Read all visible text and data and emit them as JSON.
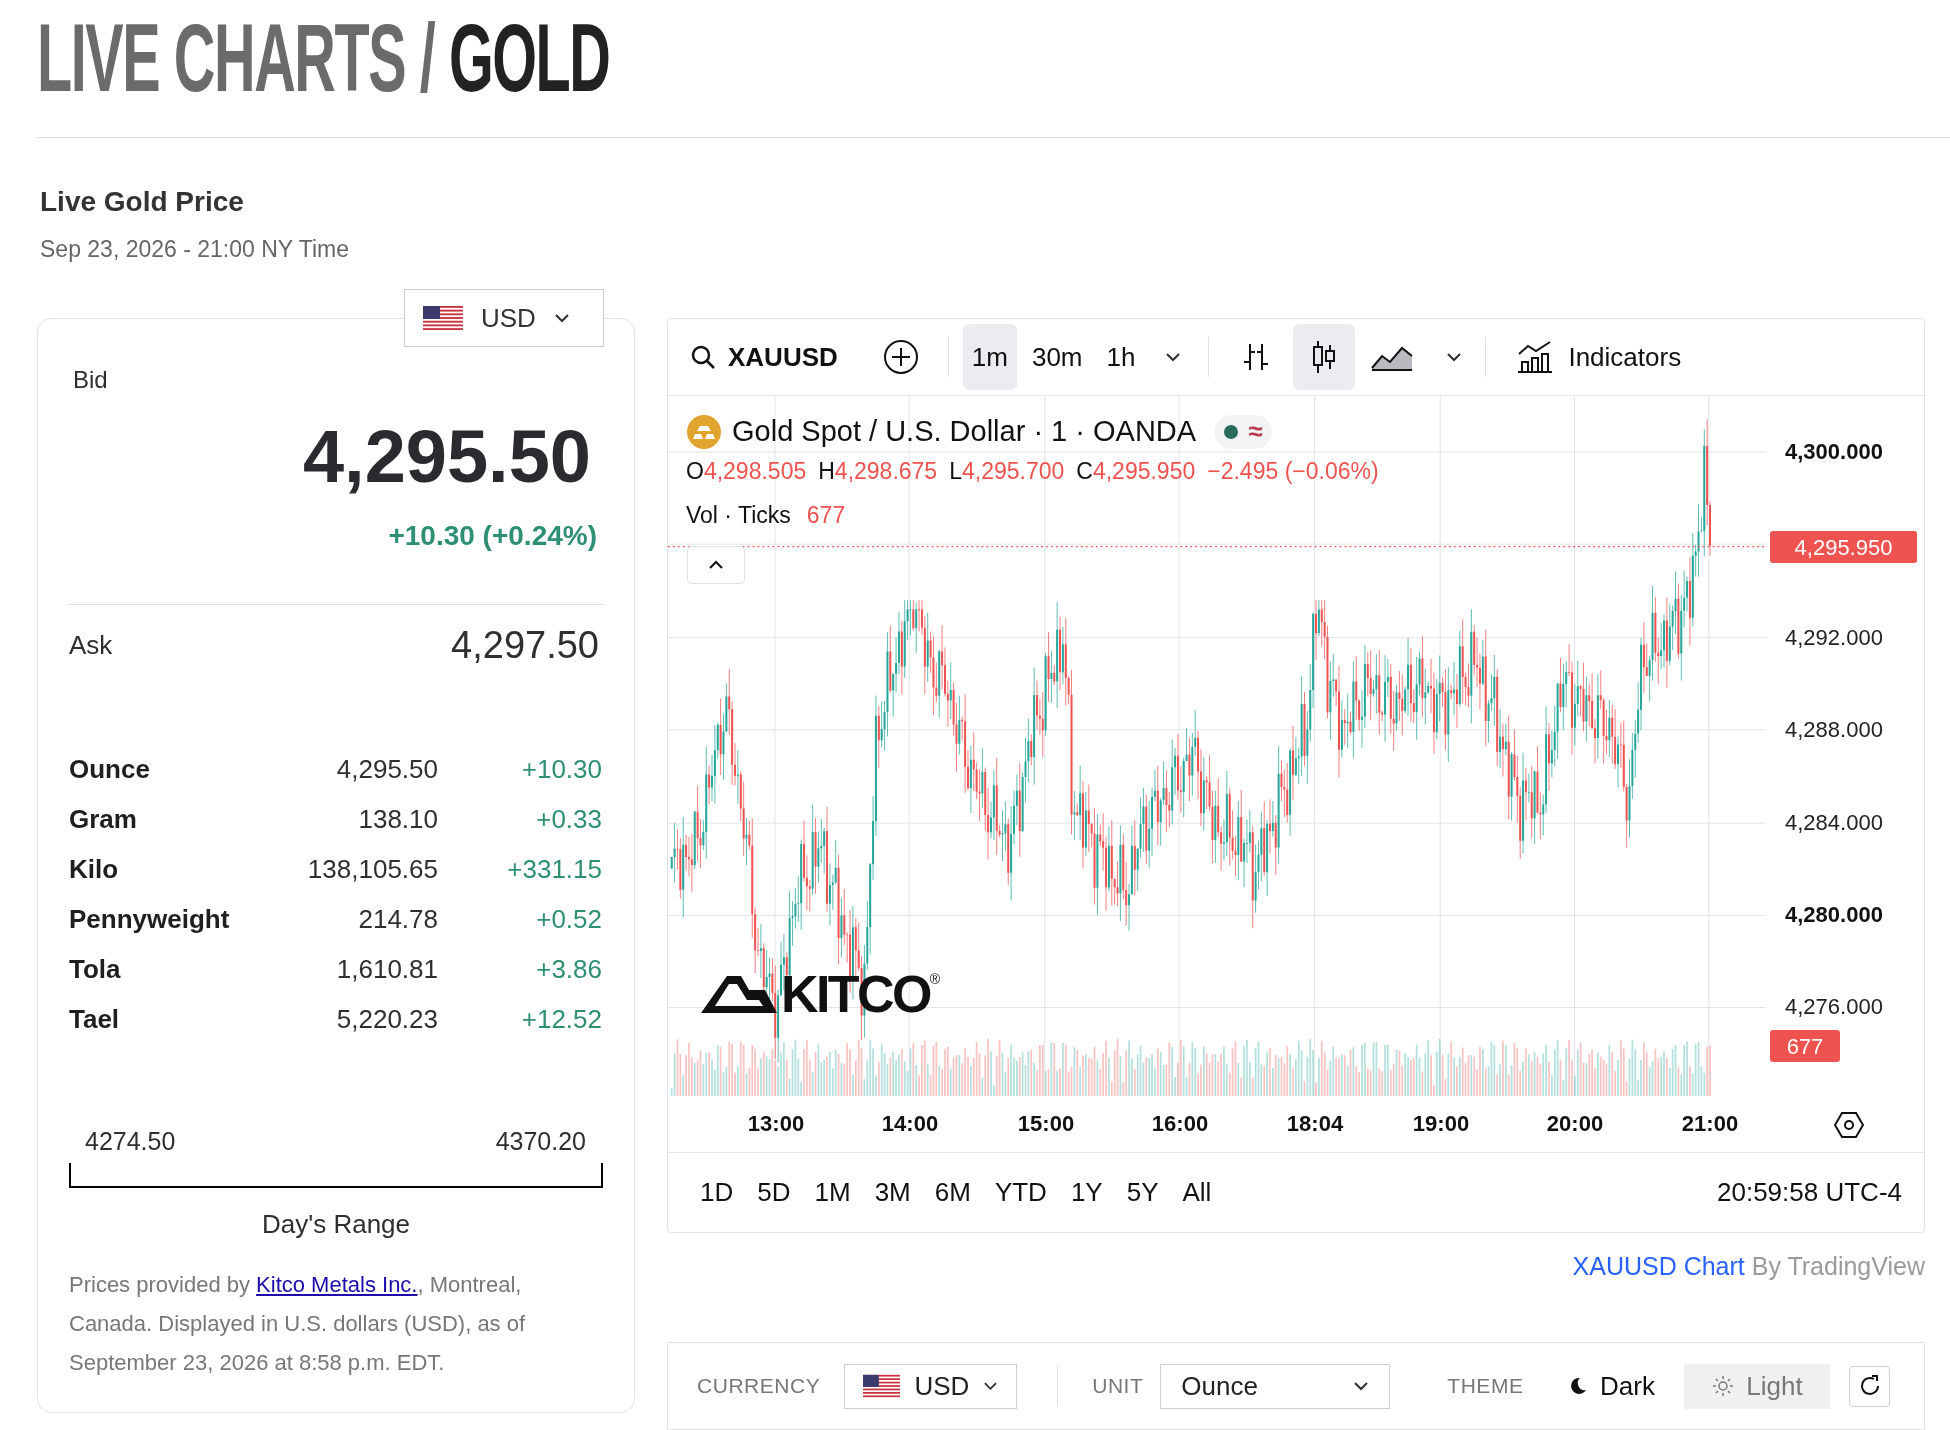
{
  "page_title": {
    "prefix": "LIVE CHARTS /",
    "subject": "GOLD"
  },
  "heading": "Live Gold Price",
  "timestamp": "Sep 23, 2026 - 21:00 NY Time",
  "price_card": {
    "currency": "USD",
    "bid_label": "Bid",
    "bid": "4,295.50",
    "change": "+10.30 (+0.24%)",
    "ask_label": "Ask",
    "ask": "4,297.50",
    "units": [
      {
        "name": "Ounce",
        "price": "4,295.50",
        "change": "+10.30"
      },
      {
        "name": "Gram",
        "price": "138.10",
        "change": "+0.33"
      },
      {
        "name": "Kilo",
        "price": "138,105.65",
        "change": "+331.15"
      },
      {
        "name": "Pennyweight",
        "price": "214.78",
        "change": "+0.52"
      },
      {
        "name": "Tola",
        "price": "1,610.81",
        "change": "+3.86"
      },
      {
        "name": "Tael",
        "price": "5,220.23",
        "change": "+12.52"
      }
    ],
    "range": {
      "low": "4274.50",
      "high": "4370.20",
      "label": "Day's Range"
    },
    "footnote": {
      "before": "Prices provided by ",
      "link": "Kitco Metals Inc.",
      "after": ", Montreal, Canada. Displayed in U.S. dollars (USD), as of September 23, 2026 at 8:58 p.m. EDT."
    }
  },
  "chart": {
    "symbol": "XAUUSD",
    "intervals": [
      {
        "label": "1m",
        "selected": true
      },
      {
        "label": "30m",
        "selected": false
      },
      {
        "label": "1h",
        "selected": false
      }
    ],
    "chart_types": [
      {
        "kind": "bars",
        "selected": false
      },
      {
        "kind": "candles",
        "selected": true
      },
      {
        "kind": "area",
        "selected": false
      }
    ],
    "indicators": "Indicators",
    "legend": {
      "title": "Gold Spot / U.S. Dollar · 1 · OANDA",
      "status": "≈",
      "ohlc": [
        {
          "label": "O",
          "value": "4,298.505"
        },
        {
          "label": "H",
          "value": "4,298.675"
        },
        {
          "label": "L",
          "value": "4,295.700"
        },
        {
          "label": "C",
          "value": "4,295.950"
        }
      ],
      "change": "−2.495 (−0.06%)",
      "volume_label": "Vol · Ticks",
      "volume": "677"
    },
    "logo": {
      "text": "KITCO",
      "mark": "®"
    },
    "price_axis": [
      {
        "label": "4,300.000",
        "major": true
      },
      {
        "label": "4,292.000",
        "major": false
      },
      {
        "label": "4,288.000",
        "major": false
      },
      {
        "label": "4,284.000",
        "major": false
      },
      {
        "label": "4,280.000",
        "major": true
      },
      {
        "label": "4,276.000",
        "major": false
      }
    ],
    "last_price": "4,295.950",
    "last_volume": "677",
    "time_axis": [
      "13:00",
      "14:00",
      "15:00",
      "16:00",
      "18:04",
      "19:00",
      "20:00",
      "21:00"
    ],
    "ranges": [
      "1D",
      "5D",
      "1M",
      "3M",
      "6M",
      "YTD",
      "1Y",
      "5Y",
      "All"
    ],
    "clock": "20:59:58 UTC-4"
  },
  "attribution": {
    "link": "XAUUSD Chart",
    "text": " By TradingView"
  },
  "controls": {
    "currency_label": "CURRENCY",
    "currency": "USD",
    "unit_label": "UNIT",
    "unit": "Ounce",
    "theme_label": "THEME",
    "themes": [
      {
        "label": "Dark",
        "selected": false
      },
      {
        "label": "Light",
        "selected": true
      }
    ]
  }
}
